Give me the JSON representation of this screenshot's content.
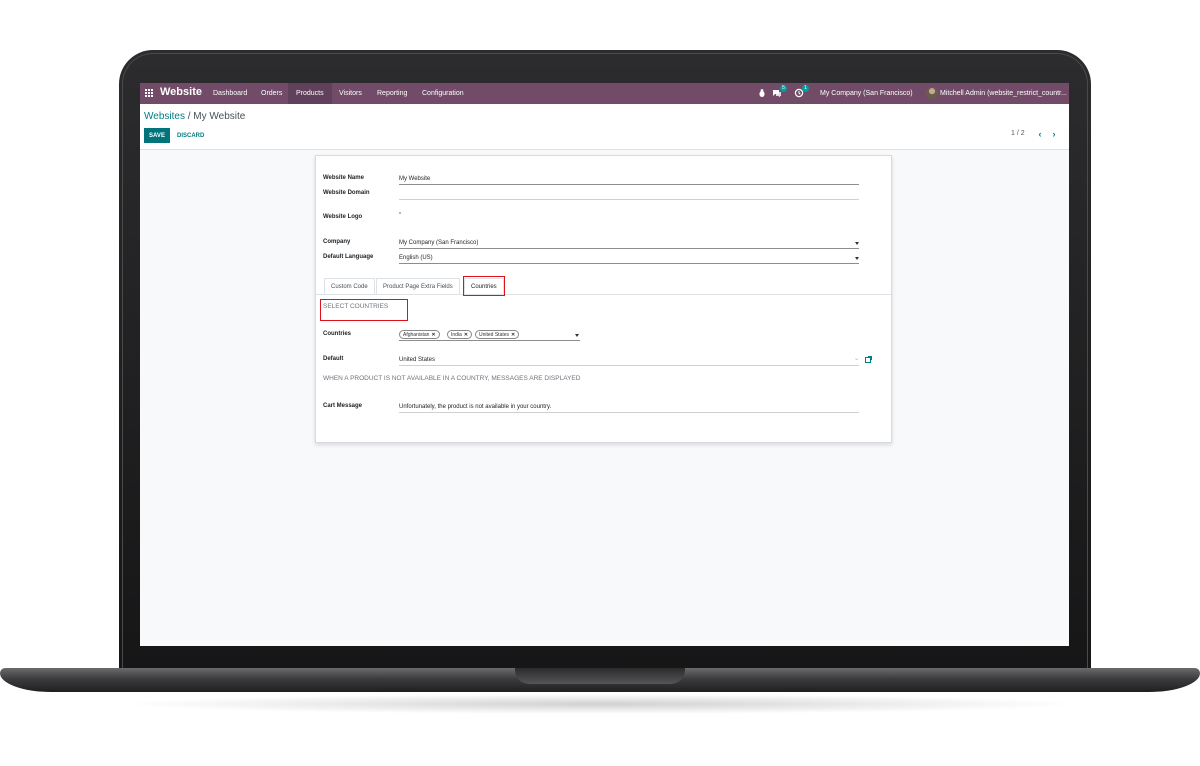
{
  "navbar": {
    "app_name": "Website",
    "menu": [
      "Dashboard",
      "Orders",
      "Products",
      "Visitors",
      "Reporting",
      "Configuration"
    ],
    "active_menu": "Products",
    "messages_count": "5",
    "activities_count": "1",
    "company": "My Company (San Francisco)",
    "user": "Mitchell Admin (website_restrict_countr..."
  },
  "breadcrumb": {
    "parent": "Websites",
    "separator": "/",
    "current": "My Website"
  },
  "buttons": {
    "save": "SAVE",
    "discard": "DISCARD"
  },
  "pager": {
    "value": "1 / 2",
    "prev": "‹",
    "next": "›"
  },
  "form": {
    "website_name_label": "Website Name",
    "website_name": "My Website",
    "website_domain_label": "Website Domain",
    "website_domain": "",
    "website_logo_label": "Website Logo",
    "company_label": "Company",
    "company": "My Company (San Francisco)",
    "language_label": "Default Language",
    "language": "English (US)"
  },
  "tabs": [
    "Custom Code",
    "Product Page Extra Fields",
    "Countries"
  ],
  "active_tab": "Countries",
  "countries_tab": {
    "section_title": "SELECT COUNTRIES",
    "countries_label": "Countries",
    "country_tags": [
      "Afghanistan",
      "India",
      "United States"
    ],
    "default_label": "Default",
    "default_value": "United States",
    "messages_title": "WHEN A PRODUCT IS NOT AVAILABLE IN A COUNTRY, MESSAGES ARE DISPLAYED",
    "cart_message_label": "Cart Message",
    "cart_message": "Unfortunately, the product is not available in your country."
  },
  "colors": {
    "navbar": "#714b67",
    "primary": "#00747a",
    "link": "#017e84",
    "highlight": "#e0101d"
  }
}
